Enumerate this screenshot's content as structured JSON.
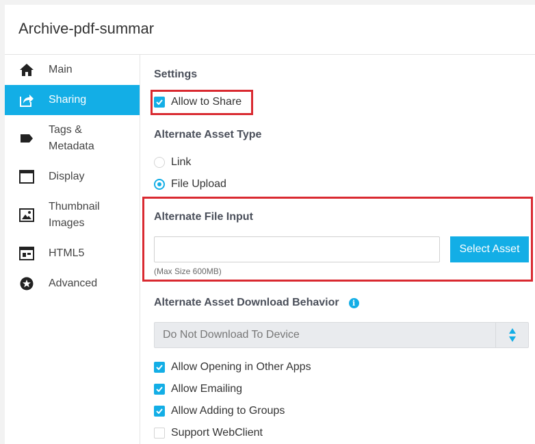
{
  "app": {
    "title": "Archive-pdf-summar"
  },
  "sidebar": {
    "items": [
      {
        "label_line1": "Main",
        "label_line2": "",
        "icon": "home-icon",
        "active": false
      },
      {
        "label_line1": "Sharing",
        "label_line2": "",
        "icon": "share-icon",
        "active": true
      },
      {
        "label_line1": "Tags &",
        "label_line2": "Metadata",
        "icon": "tag-icon",
        "active": false
      },
      {
        "label_line1": "Display",
        "label_line2": "",
        "icon": "display-icon",
        "active": false
      },
      {
        "label_line1": "Thumbnail",
        "label_line2": "Images",
        "icon": "image-icon",
        "active": false
      },
      {
        "label_line1": "HTML5",
        "label_line2": "",
        "icon": "html5-icon",
        "active": false
      },
      {
        "label_line1": "Advanced",
        "label_line2": "",
        "icon": "star-icon",
        "active": false
      }
    ]
  },
  "settings": {
    "title": "Settings",
    "allow_share": {
      "label": "Allow to Share",
      "checked": true
    }
  },
  "alternate_asset_type": {
    "title": "Alternate Asset Type",
    "options": [
      {
        "label": "Link",
        "selected": false
      },
      {
        "label": "File Upload",
        "selected": true
      }
    ]
  },
  "alternate_file_input": {
    "title": "Alternate File Input",
    "value": "",
    "button_label": "Select Asset",
    "hint": "(Max Size 600MB)"
  },
  "download_behavior": {
    "title": "Alternate Asset Download Behavior",
    "info_icon": "info-icon",
    "selected": "Do Not Download To Device"
  },
  "options": [
    {
      "label": "Allow Opening in Other Apps",
      "checked": true
    },
    {
      "label": "Allow Emailing",
      "checked": true
    },
    {
      "label": "Allow Adding to Groups",
      "checked": true
    },
    {
      "label": "Support WebClient",
      "checked": false
    }
  ],
  "colors": {
    "accent": "#13aee6",
    "highlight": "#d92930"
  }
}
